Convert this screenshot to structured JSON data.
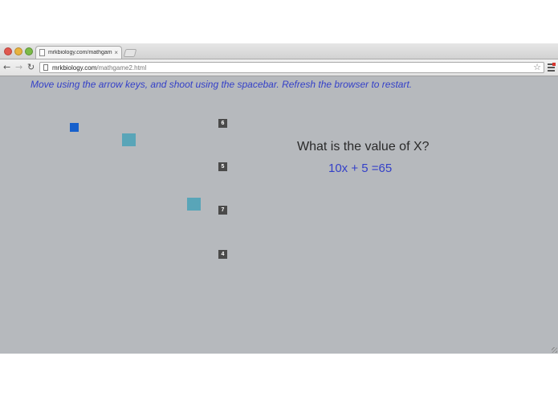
{
  "browser": {
    "tab": {
      "title": "mrkbiology.com/mathgame",
      "close": "×"
    },
    "nav": {
      "back": "←",
      "forward": "→",
      "reload": "↻"
    },
    "url": {
      "domain": "mrkbiology.com",
      "path": "/mathgame2.html"
    },
    "star": "☆"
  },
  "game": {
    "instructions": "Move using the arrow keys, and shoot using the spacebar. Refresh the browser to restart.",
    "question": "What is the value of X?",
    "equation": "10x + 5 =65",
    "answers": [
      "6",
      "5",
      "7",
      "4"
    ],
    "colors": {
      "player": "#1660cc",
      "enemy": "#59a5b8",
      "answer_box": "#4a4a4a",
      "background": "#b6b9bd"
    }
  }
}
